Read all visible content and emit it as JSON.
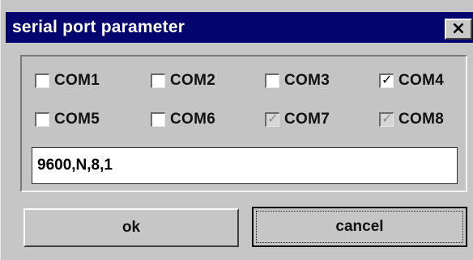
{
  "window": {
    "title": "serial port parameter",
    "close_glyph": "×"
  },
  "ports": [
    {
      "label": "COM1",
      "checked": false,
      "disabled": false
    },
    {
      "label": "COM2",
      "checked": false,
      "disabled": false
    },
    {
      "label": "COM3",
      "checked": false,
      "disabled": false
    },
    {
      "label": "COM4",
      "checked": true,
      "disabled": false
    },
    {
      "label": "COM5",
      "checked": false,
      "disabled": false
    },
    {
      "label": "COM6",
      "checked": false,
      "disabled": false
    },
    {
      "label": "COM7",
      "checked": true,
      "disabled": true
    },
    {
      "label": "COM8",
      "checked": true,
      "disabled": true
    }
  ],
  "settings": {
    "value": "9600,N,8,1"
  },
  "buttons": {
    "ok_label": "ok",
    "cancel_label": "cancel"
  },
  "colors": {
    "titlebar": "#050570",
    "face": "#c6c6c6"
  },
  "icons": {
    "close": "close-icon",
    "check": "check-icon"
  }
}
